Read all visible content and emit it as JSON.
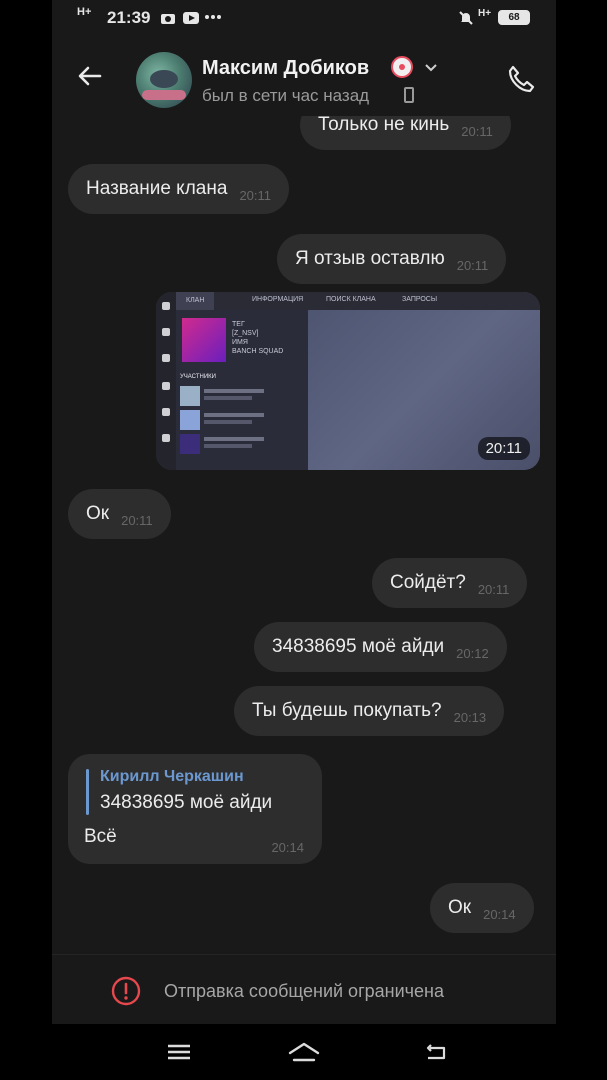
{
  "status_bar": {
    "signal": "H+",
    "time": "21:39",
    "network": "H+",
    "battery": "68",
    "icons": [
      "camera-icon",
      "youtube-icon",
      "more-icon",
      "mute-icon"
    ]
  },
  "header": {
    "contact_name": "Максим Добиков",
    "status": "был в сети час назад",
    "back_icon": "back-arrow-icon",
    "call_icon": "phone-icon"
  },
  "messages": [
    {
      "side": "out",
      "text": "Только не кинь",
      "time": "20:11"
    },
    {
      "side": "in",
      "text": "Название клана",
      "time": "20:11"
    },
    {
      "side": "out",
      "text": "Я отзыв оставлю",
      "time": "20:11"
    },
    {
      "side": "out",
      "type": "photo",
      "time": "20:11"
    },
    {
      "side": "in",
      "text": "Ок",
      "time": "20:11"
    },
    {
      "side": "out",
      "text": "Сойдёт?",
      "time": "20:11"
    },
    {
      "side": "out",
      "text": "34838695 моё айди",
      "time": "20:12"
    },
    {
      "side": "out",
      "text": "Ты будешь покупать?",
      "time": "20:13"
    },
    {
      "side": "in",
      "type": "reply",
      "reply_author": "Кирилл Черкашин",
      "reply_text": "34838695 моё айди",
      "text": "Всё",
      "time": "20:14"
    },
    {
      "side": "out",
      "text": "Ок",
      "time": "20:14"
    }
  ],
  "photo": {
    "tabs": [
      "КЛАН",
      "ИНФОРМАЦИЯ",
      "ПОИСК КЛАНА",
      "ЗАПРОСЫ"
    ],
    "clan_info": [
      "ТЕГ",
      "[Z_NSV]",
      "ИМЯ",
      "BANCH SQUAD"
    ],
    "members_header": "УЧАСТНИКИ",
    "timestamp": "20:11"
  },
  "restriction": {
    "text": "Отправка сообщений ограничена",
    "icon": "warning-circle-icon",
    "accent": "#e5484d"
  },
  "navbar": {
    "icons": [
      "menu-icon",
      "home-icon",
      "back-icon"
    ]
  },
  "colors": {
    "background": "#19191a",
    "bubble": "#2d2d2e",
    "reply_accent": "#6c98d0"
  }
}
